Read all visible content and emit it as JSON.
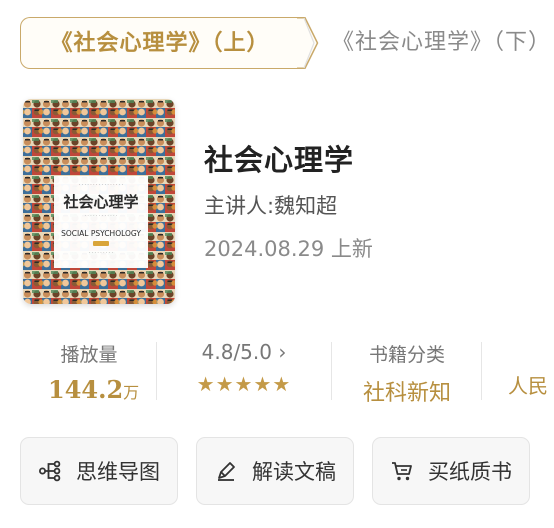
{
  "tabs": {
    "active_label": "《社会心理学》（上）",
    "inactive_label": "《社会心理学》（下）"
  },
  "book": {
    "title": "社会心理学",
    "author": "主讲人:魏知超",
    "date": "2024.08.29 上新",
    "cover": {
      "cn_title": "社会心理学",
      "en_title": "SOCIAL PSYCHOLOGY"
    }
  },
  "stats": {
    "plays_label": "播放量",
    "plays_value": "144.2",
    "plays_unit": "万",
    "rating_label": "4.8/5.0",
    "rating_chevron": "›",
    "rating_stars": "★★★★★",
    "category_label": "书籍分类",
    "category_value": "社科新知",
    "publisher_partial": "人民"
  },
  "actions": {
    "mindmap": "思维导图",
    "interpretation": "解读文稿",
    "buy": "买纸质书"
  },
  "colors": {
    "accent": "#b78f3f",
    "tab_border": "#c9a96a",
    "star": "#c49a48"
  },
  "icons": [
    "mindmap-icon",
    "pen-icon",
    "cart-icon",
    "chevron-right-icon",
    "star-icon"
  ]
}
